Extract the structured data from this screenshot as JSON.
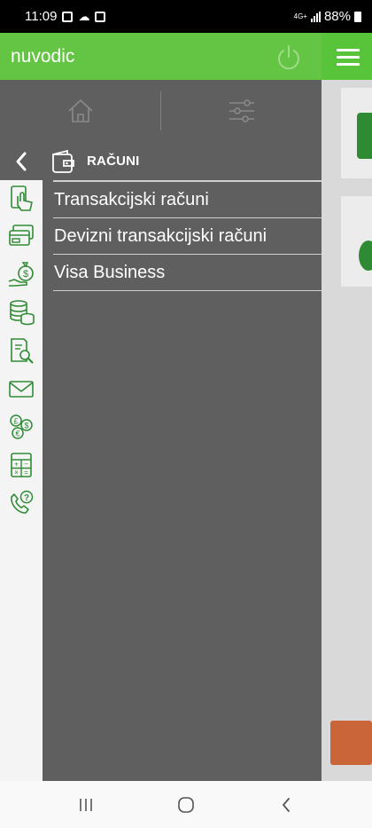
{
  "status_bar": {
    "time": "11:09",
    "network": "4G+",
    "battery": "88%"
  },
  "drawer": {
    "app_title": "nuvodic",
    "section_title": "RAČUNI",
    "menu_items": [
      "Transakcijski računi",
      "Devizni transakcijski računi",
      "Visa Business"
    ]
  },
  "sidebar_icons": [
    "touch-payment-icon",
    "card-icon",
    "money-bag-hand-icon",
    "coins-stack-icon",
    "document-search-icon",
    "envelope-icon",
    "currency-exchange-icon",
    "calculator-icon",
    "phone-support-icon"
  ],
  "colors": {
    "header_green": "#64c545",
    "icon_green": "#2e8b34",
    "drawer_bg": "#5f5f5f",
    "sidebar_bg": "#f4f4f4"
  }
}
